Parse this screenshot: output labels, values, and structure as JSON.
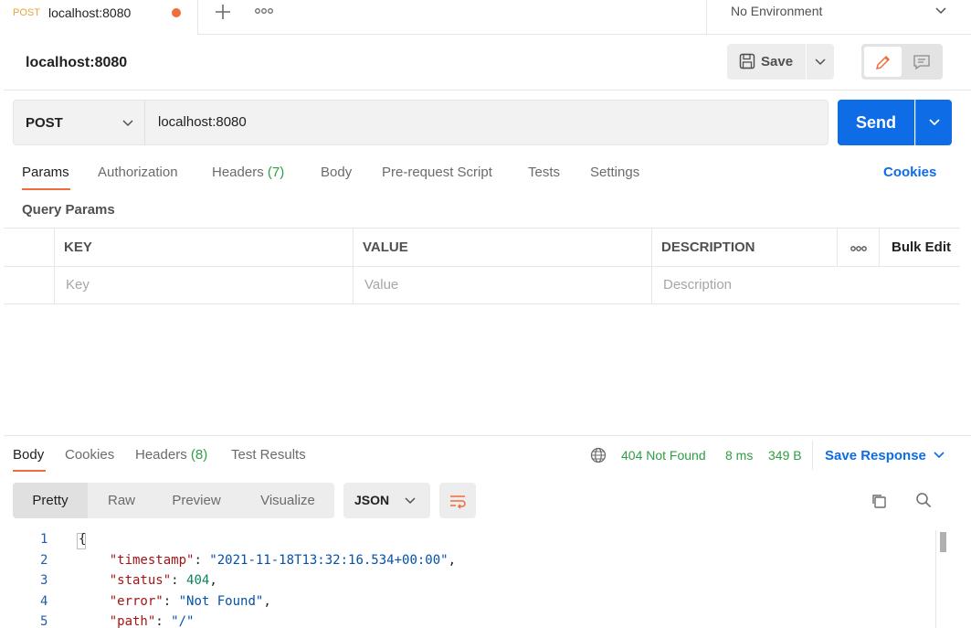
{
  "tabstrip": {
    "active_tab": {
      "method": "POST",
      "name": "localhost:8080"
    },
    "environment": "No Environment"
  },
  "request": {
    "title": "localhost:8080",
    "save_label": "Save",
    "method": "POST",
    "url": "localhost:8080",
    "send_label": "Send",
    "tabs": [
      {
        "label": "Params"
      },
      {
        "label": "Authorization"
      },
      {
        "label": "Headers",
        "count": "(7)"
      },
      {
        "label": "Body"
      },
      {
        "label": "Pre-request Script"
      },
      {
        "label": "Tests"
      },
      {
        "label": "Settings"
      }
    ],
    "cookies_label": "Cookies",
    "query_params_title": "Query Params",
    "table": {
      "headers": [
        "KEY",
        "VALUE",
        "DESCRIPTION"
      ],
      "placeholders": [
        "Key",
        "Value",
        "Description"
      ],
      "bulk_edit_label": "Bulk Edit"
    }
  },
  "response": {
    "tabs": [
      {
        "label": "Body"
      },
      {
        "label": "Cookies"
      },
      {
        "label": "Headers",
        "count": "(8)"
      },
      {
        "label": "Test Results"
      }
    ],
    "status": "404 Not Found",
    "time": "8 ms",
    "size": "349 B",
    "save_response_label": "Save Response",
    "view_modes": [
      "Pretty",
      "Raw",
      "Preview",
      "Visualize"
    ],
    "format": "JSON",
    "code_lines": [
      {
        "n": "1",
        "parts": [
          {
            "t": "p",
            "v": "{"
          }
        ]
      },
      {
        "n": "2",
        "parts": [
          {
            "t": "p",
            "v": "    "
          },
          {
            "t": "k",
            "v": "\"timestamp\""
          },
          {
            "t": "p",
            "v": ": "
          },
          {
            "t": "s",
            "v": "\"2021-11-18T13:32:16.534+00:00\""
          },
          {
            "t": "p",
            "v": ","
          }
        ]
      },
      {
        "n": "3",
        "parts": [
          {
            "t": "p",
            "v": "    "
          },
          {
            "t": "k",
            "v": "\"status\""
          },
          {
            "t": "p",
            "v": ": "
          },
          {
            "t": "n",
            "v": "404"
          },
          {
            "t": "p",
            "v": ","
          }
        ]
      },
      {
        "n": "4",
        "parts": [
          {
            "t": "p",
            "v": "    "
          },
          {
            "t": "k",
            "v": "\"error\""
          },
          {
            "t": "p",
            "v": ": "
          },
          {
            "t": "s",
            "v": "\"Not Found\""
          },
          {
            "t": "p",
            "v": ","
          }
        ]
      },
      {
        "n": "5",
        "parts": [
          {
            "t": "p",
            "v": "    "
          },
          {
            "t": "k",
            "v": "\"path\""
          },
          {
            "t": "p",
            "v": ": "
          },
          {
            "t": "s",
            "v": "\"/\""
          }
        ]
      }
    ]
  },
  "colors": {
    "accent": "#f26b3a",
    "primary": "#0d6ce6",
    "success": "#2f9e44",
    "post_method": "#e8a33d"
  }
}
